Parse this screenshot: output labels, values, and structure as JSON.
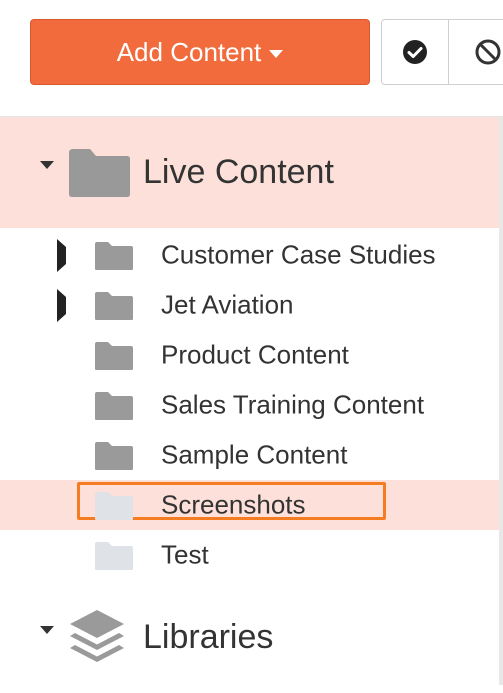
{
  "toolbar": {
    "add_content_label": "Add Content",
    "check_icon": "check-circle-icon",
    "block_icon": "ban-icon"
  },
  "tree": {
    "live_content": {
      "label": "Live Content",
      "icon": "folder-icon",
      "expanded": true,
      "children": [
        {
          "label": "Customer Case Studies",
          "has_children": true,
          "folder_color": "#9a9a9a"
        },
        {
          "label": "Jet Aviation",
          "has_children": true,
          "folder_color": "#9a9a9a"
        },
        {
          "label": "Product Content",
          "has_children": false,
          "folder_color": "#9a9a9a"
        },
        {
          "label": "Sales Training Content",
          "has_children": false,
          "folder_color": "#9a9a9a"
        },
        {
          "label": "Sample Content",
          "has_children": false,
          "folder_color": "#9a9a9a"
        },
        {
          "label": "Screenshots",
          "has_children": false,
          "folder_color": "#dfe3e8",
          "selected": true
        },
        {
          "label": "Test",
          "has_children": false,
          "folder_color": "#dfe3e8"
        }
      ]
    },
    "libraries": {
      "label": "Libraries",
      "icon": "layers-icon",
      "expanded": true
    }
  },
  "colors": {
    "accent": "#f26b3d",
    "selection_bg": "#fde0d9",
    "selection_outline": "#f57c20"
  }
}
